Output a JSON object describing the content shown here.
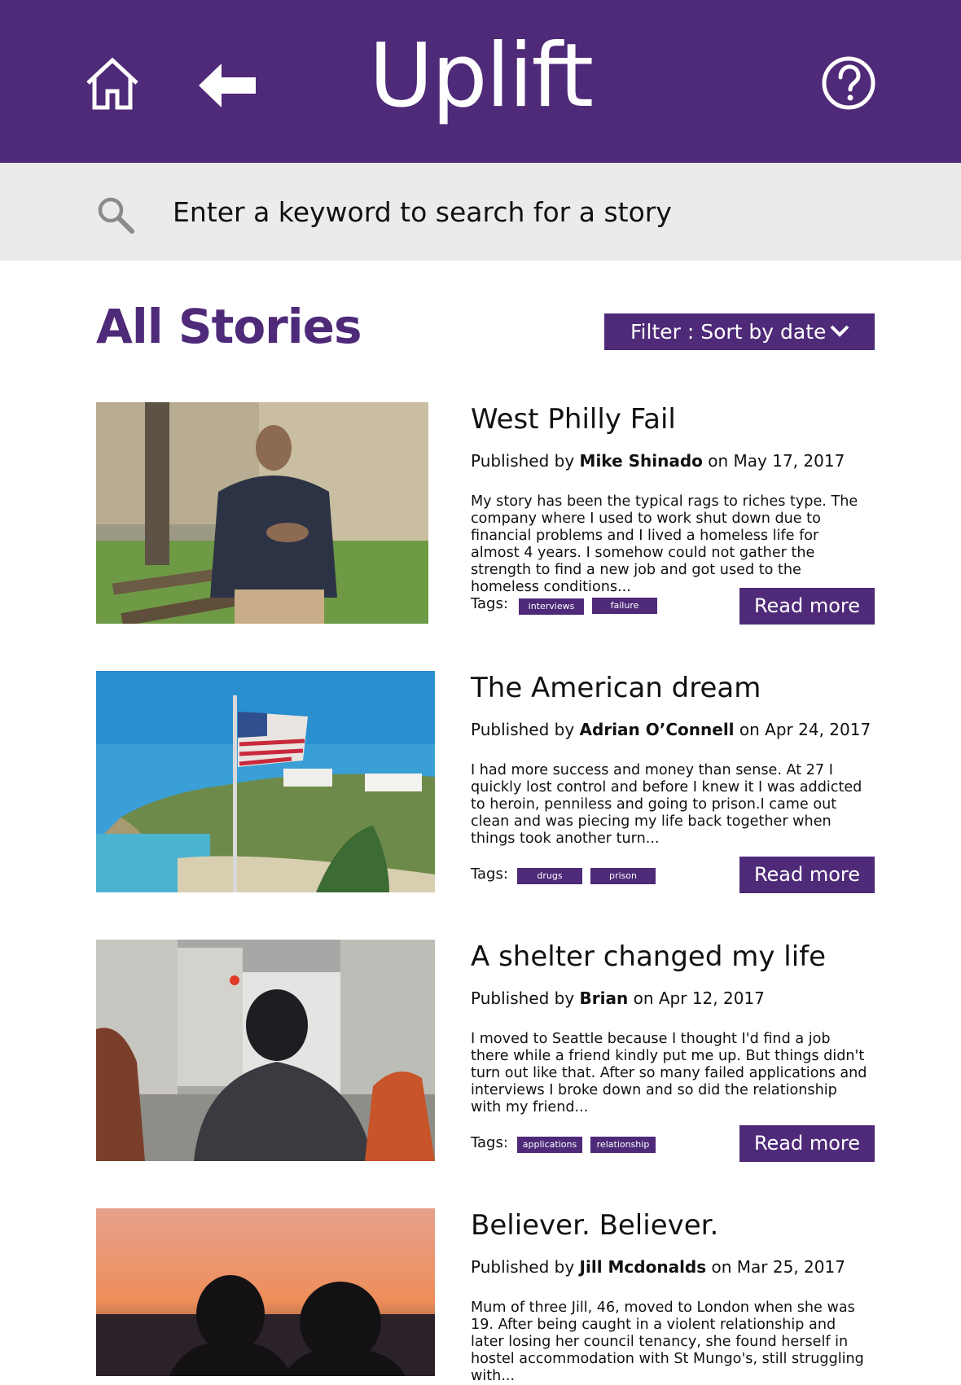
{
  "app": {
    "title": "Uplift"
  },
  "header": {
    "icons": [
      "home-icon",
      "back-arrow-icon",
      "help-icon"
    ]
  },
  "search": {
    "placeholder": "Enter a keyword to search for a story",
    "icon": "search-icon"
  },
  "main": {
    "title": "All Stories"
  },
  "filter": {
    "label": "Filter : Sort by date",
    "icon": "chevron-down-icon"
  },
  "theme": {
    "accent": "#4e2a78",
    "search_bg": "#ebebeb",
    "text": "#111111"
  },
  "stories": [
    {
      "title": "West Philly Fail",
      "published_prefix": "Published by ",
      "author": "Mike Shinado",
      "date_text": "on May 17, 2017",
      "excerpt": "My story has been the typical rags to riches type. The company where I used to work shut down due to financial problems and I lived a homeless life for almost 4 years. I somehow could not gather the strength to find a new job and got used to the homeless conditions...",
      "tags_label": "Tags:",
      "tags": [
        "interviews",
        "failure"
      ],
      "read_more": "Read more"
    },
    {
      "title": "The American dream",
      "published_prefix": "Published by ",
      "author": "Adrian O’Connell",
      "date_text": "on Apr 24, 2017",
      "excerpt": "I had more success and money than sense. At 27 I quickly lost control and before I knew it I was addicted to heroin, penniless and going to prison.I came out clean and was piecing my life back together when things took another turn...",
      "tags_label": "Tags:",
      "tags": [
        "drugs",
        "prison"
      ],
      "read_more": "Read more"
    },
    {
      "title": "A shelter changed my life",
      "published_prefix": "Published by ",
      "author": "Brian",
      "date_text": "on Apr 12, 2017",
      "excerpt": "I moved to Seattle because I thought I'd find a job there while a friend kindly put me up. But things didn't turn out like that. After so many failed applications and interviews I broke down and so did the relationship with my friend...",
      "tags_label": "Tags:",
      "tags": [
        "applications",
        "relationship"
      ],
      "read_more": "Read more"
    },
    {
      "title": "Believer. Believer.",
      "published_prefix": "Published by ",
      "author": "Jill Mcdonalds",
      "date_text": "on Mar 25, 2017",
      "excerpt": "Mum of three Jill, 46, moved to London when she was 19. After being caught in a violent relationship and later losing her council tenancy, she found herself in hostel accommodation with St Mungo's, still struggling with...",
      "tags_label": "",
      "tags": [],
      "read_more": ""
    }
  ]
}
